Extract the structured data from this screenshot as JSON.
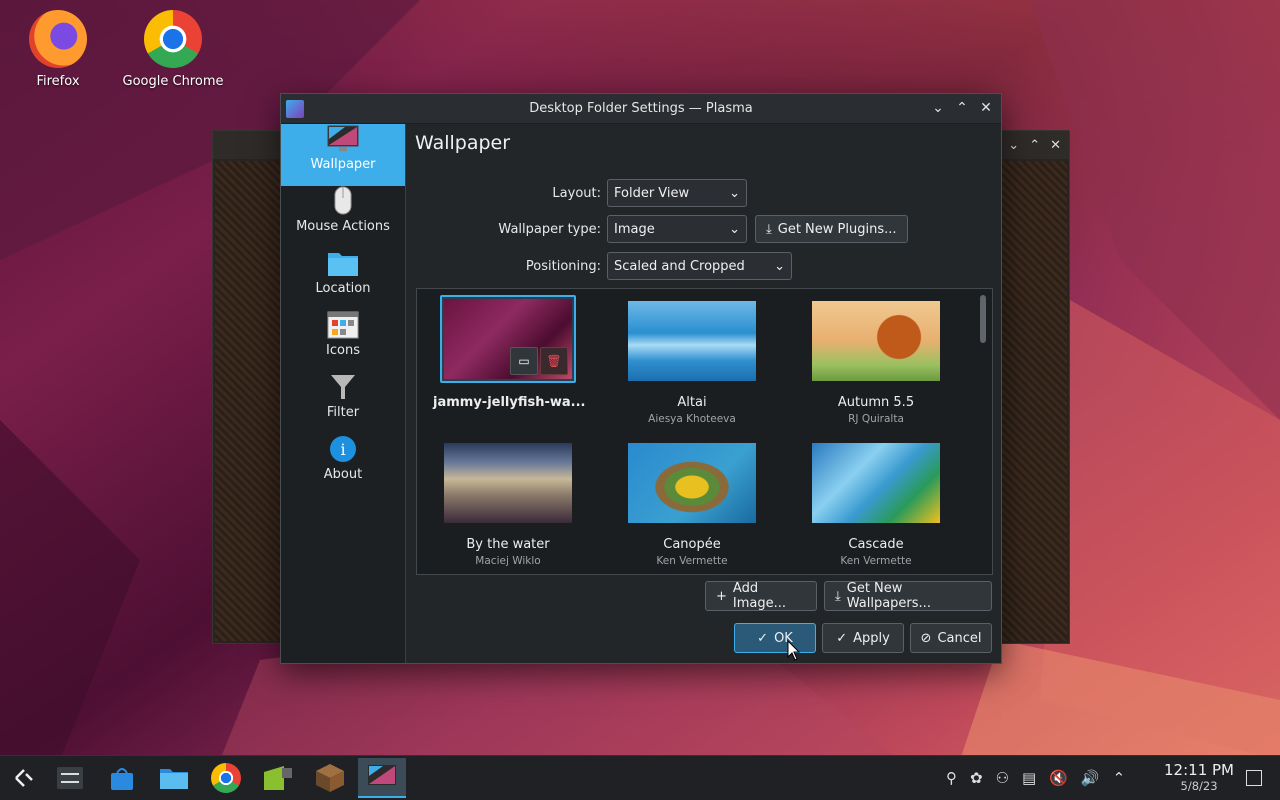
{
  "desktop": {
    "icons": [
      {
        "label": "Firefox"
      },
      {
        "label": "Google Chrome"
      }
    ]
  },
  "dialog": {
    "title": "Desktop Folder Settings — Plasma",
    "sidebar": [
      {
        "label": "Wallpaper",
        "icon": "monitor-icon"
      },
      {
        "label": "Mouse Actions",
        "icon": "mouse-icon"
      },
      {
        "label": "Location",
        "icon": "folder-icon"
      },
      {
        "label": "Icons",
        "icon": "icons-grid-icon"
      },
      {
        "label": "Filter",
        "icon": "filter-icon"
      },
      {
        "label": "About",
        "icon": "info-icon"
      }
    ],
    "heading": "Wallpaper",
    "layout": {
      "label": "Layout:",
      "value": "Folder View"
    },
    "wallpaper_type": {
      "label": "Wallpaper type:",
      "value": "Image"
    },
    "get_plugins": "Get New Plugins...",
    "positioning": {
      "label": "Positioning:",
      "value": "Scaled and Cropped"
    },
    "wallpapers": [
      {
        "name": "jammy-jellyfish-wa...",
        "author": ""
      },
      {
        "name": "Altai",
        "author": "Aiesya Khoteeva"
      },
      {
        "name": "Autumn 5.5",
        "author": "RJ Quiralta"
      },
      {
        "name": "By the water",
        "author": "Maciej Wiklo"
      },
      {
        "name": "Canopée",
        "author": "Ken Vermette"
      },
      {
        "name": "Cascade",
        "author": "Ken Vermette"
      }
    ],
    "add_image": "Add Image...",
    "get_wallpapers": "Get New Wallpapers...",
    "ok": "OK",
    "apply": "Apply",
    "cancel": "Cancel"
  },
  "taskbar": {
    "clock_time": "12:11 PM",
    "clock_date": "5/8/23"
  }
}
